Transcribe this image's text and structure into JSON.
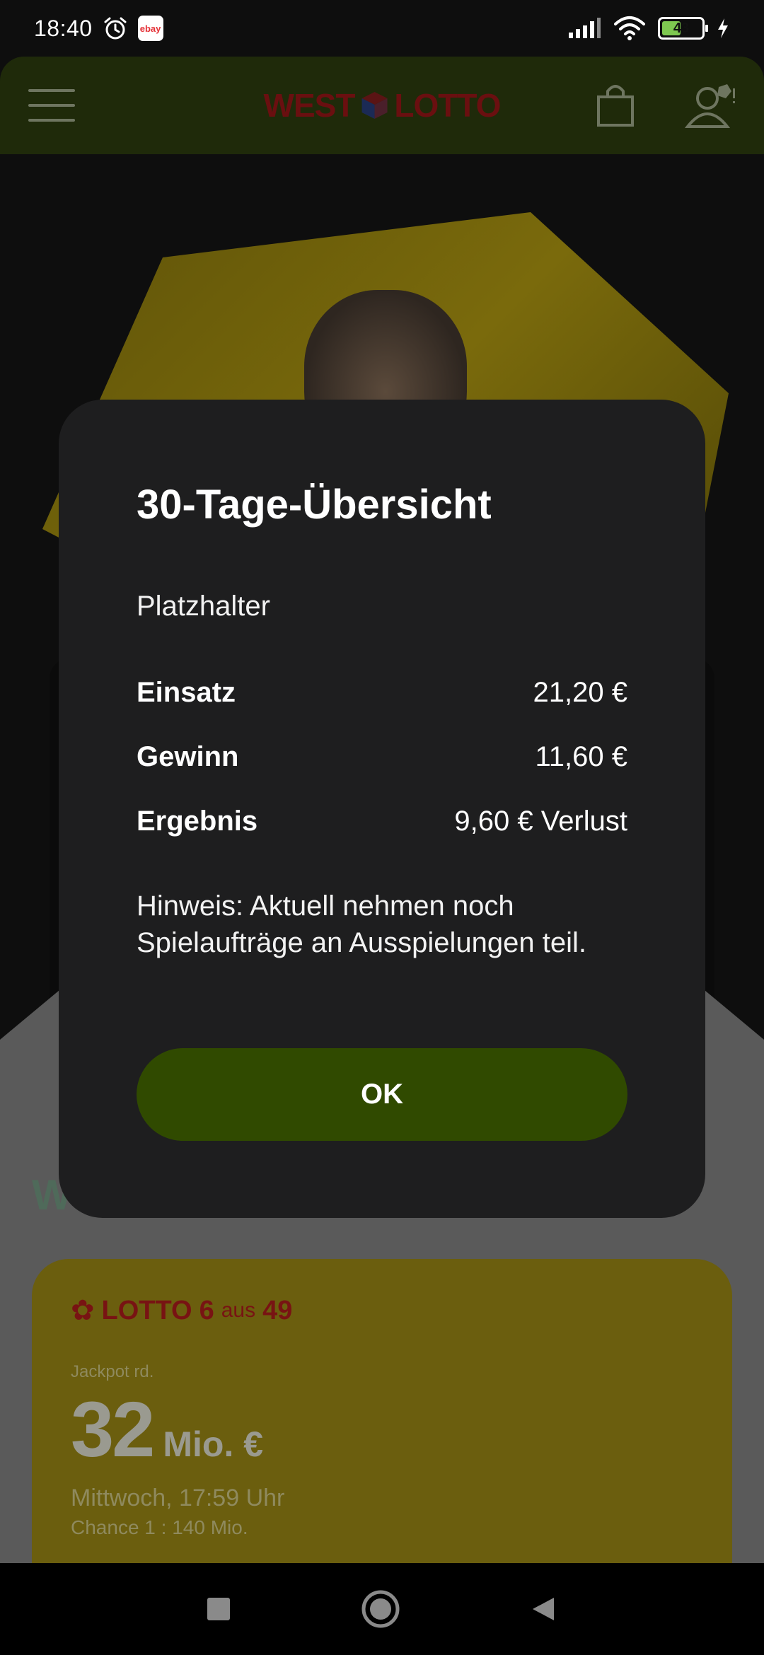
{
  "status_bar": {
    "time": "18:40",
    "ebay_label": "ebay",
    "battery_level": "43"
  },
  "header": {
    "logo_left": "WEST",
    "logo_right": "LOTTO"
  },
  "background": {
    "heading_ghost": "W",
    "lotto_card": {
      "logo_text": "LOTTO",
      "logo_six": "6",
      "logo_aus": "aus",
      "logo_49": "49",
      "jackpot_label": "Jackpot rd.",
      "jackpot_value": "32",
      "jackpot_unit": "Mio. €",
      "draw_date": "Mittwoch, 17:59 Uhr",
      "chance": "Chance 1 : 140 Mio."
    }
  },
  "dialog": {
    "title": "30-Tage-Übersicht",
    "subtitle": "Platzhalter",
    "rows": [
      {
        "label": "Einsatz",
        "value": "21,20 €"
      },
      {
        "label": "Gewinn",
        "value": "11,60 €"
      },
      {
        "label": "Ergebnis",
        "value": "9,60 € Verlust"
      }
    ],
    "note": "Hinweis: Aktuell nehmen noch Spielaufträge an Ausspielungen teil.",
    "ok_label": "OK"
  },
  "colors": {
    "dialog_bg": "#1e1e1f",
    "ok_button": "#304a00",
    "header_bg": "#1f2a0a"
  }
}
